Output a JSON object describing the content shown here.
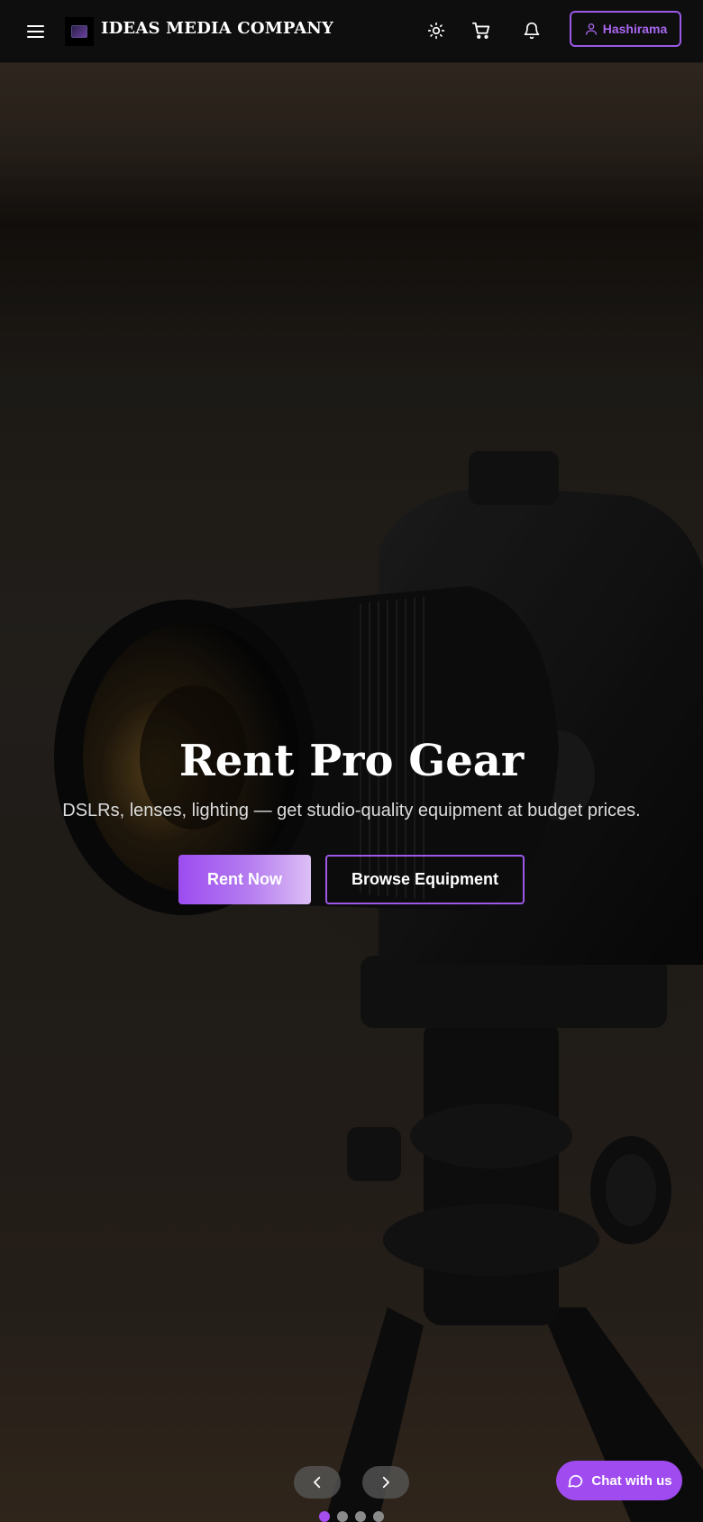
{
  "navbar": {
    "brand": "IDEAS MEDIA COMPANY",
    "user_label": "Hashirama",
    "icons": [
      "menu-icon",
      "logo",
      "sun-icon",
      "cart-icon",
      "bell-icon",
      "user-icon"
    ]
  },
  "hero": {
    "title": "Rent Pro Gear",
    "subtitle": "DSLRs, lenses, lighting — get studio-quality equipment at budget prices.",
    "primary_cta": "Rent Now",
    "secondary_cta": "Browse Equipment",
    "slide_count": 4,
    "active_slide": 1
  },
  "chat": {
    "label": "Chat with us"
  },
  "colors": {
    "accent": "#a04bf0",
    "navbar_bg": "#0e0e0e"
  }
}
